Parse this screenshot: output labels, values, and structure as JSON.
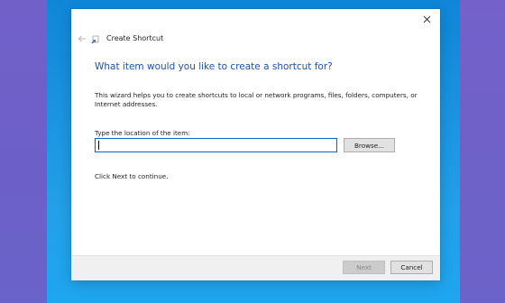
{
  "window": {
    "title": "Create Shortcut"
  },
  "wizard": {
    "heading": "What item would you like to create a shortcut for?",
    "description": "This wizard helps you to create shortcuts to local or network programs, files, folders, computers, or Internet addresses.",
    "location_label": "Type the location of the item:",
    "location_value": "",
    "browse_label": "Browse...",
    "continue_text": "Click Next to continue."
  },
  "footer": {
    "next_label": "Next",
    "cancel_label": "Cancel",
    "next_enabled": false
  },
  "icons": {
    "close": "close-icon",
    "back": "back-arrow-icon",
    "wizard": "shortcut-wizard-icon"
  },
  "colors": {
    "heading": "#1c50a8",
    "input_border": "#0b63c9",
    "desktop_center": "#1a93df",
    "desktop_side": "#6f5fc7"
  }
}
